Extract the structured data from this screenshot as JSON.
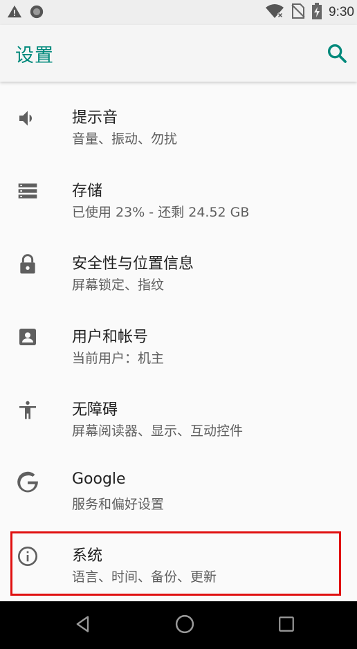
{
  "status_bar": {
    "time": "9:30",
    "icons": [
      "warning-icon",
      "record-icon",
      "wifi-off-icon",
      "no-sim-icon",
      "battery-charging-icon"
    ]
  },
  "app_bar": {
    "title": "设置",
    "accent_color": "#00897b",
    "search_icon": "search-icon"
  },
  "settings": [
    {
      "id": "sound",
      "icon": "volume-icon",
      "title": "提示音",
      "subtitle": "音量、振动、勿扰"
    },
    {
      "id": "storage",
      "icon": "storage-icon",
      "title": "存储",
      "subtitle": "已使用 23% - 还剩 24.52 GB"
    },
    {
      "id": "security",
      "icon": "lock-icon",
      "title": "安全性与位置信息",
      "subtitle": "屏幕锁定、指纹"
    },
    {
      "id": "accounts",
      "icon": "account-box-icon",
      "title": "用户和帐号",
      "subtitle": "当前用户：机主"
    },
    {
      "id": "accessibility",
      "icon": "accessibility-icon",
      "title": "无障碍",
      "subtitle": "屏幕阅读器、显示、互动控件"
    },
    {
      "id": "google",
      "icon": "google-icon",
      "title": "Google",
      "subtitle": "服务和偏好设置"
    },
    {
      "id": "system",
      "icon": "info-icon",
      "title": "系统",
      "subtitle": "语言、时间、备份、更新"
    }
  ],
  "highlight_color": "#e01010",
  "nav_bar": {
    "icons": [
      "back-icon",
      "home-icon",
      "recents-icon"
    ]
  }
}
